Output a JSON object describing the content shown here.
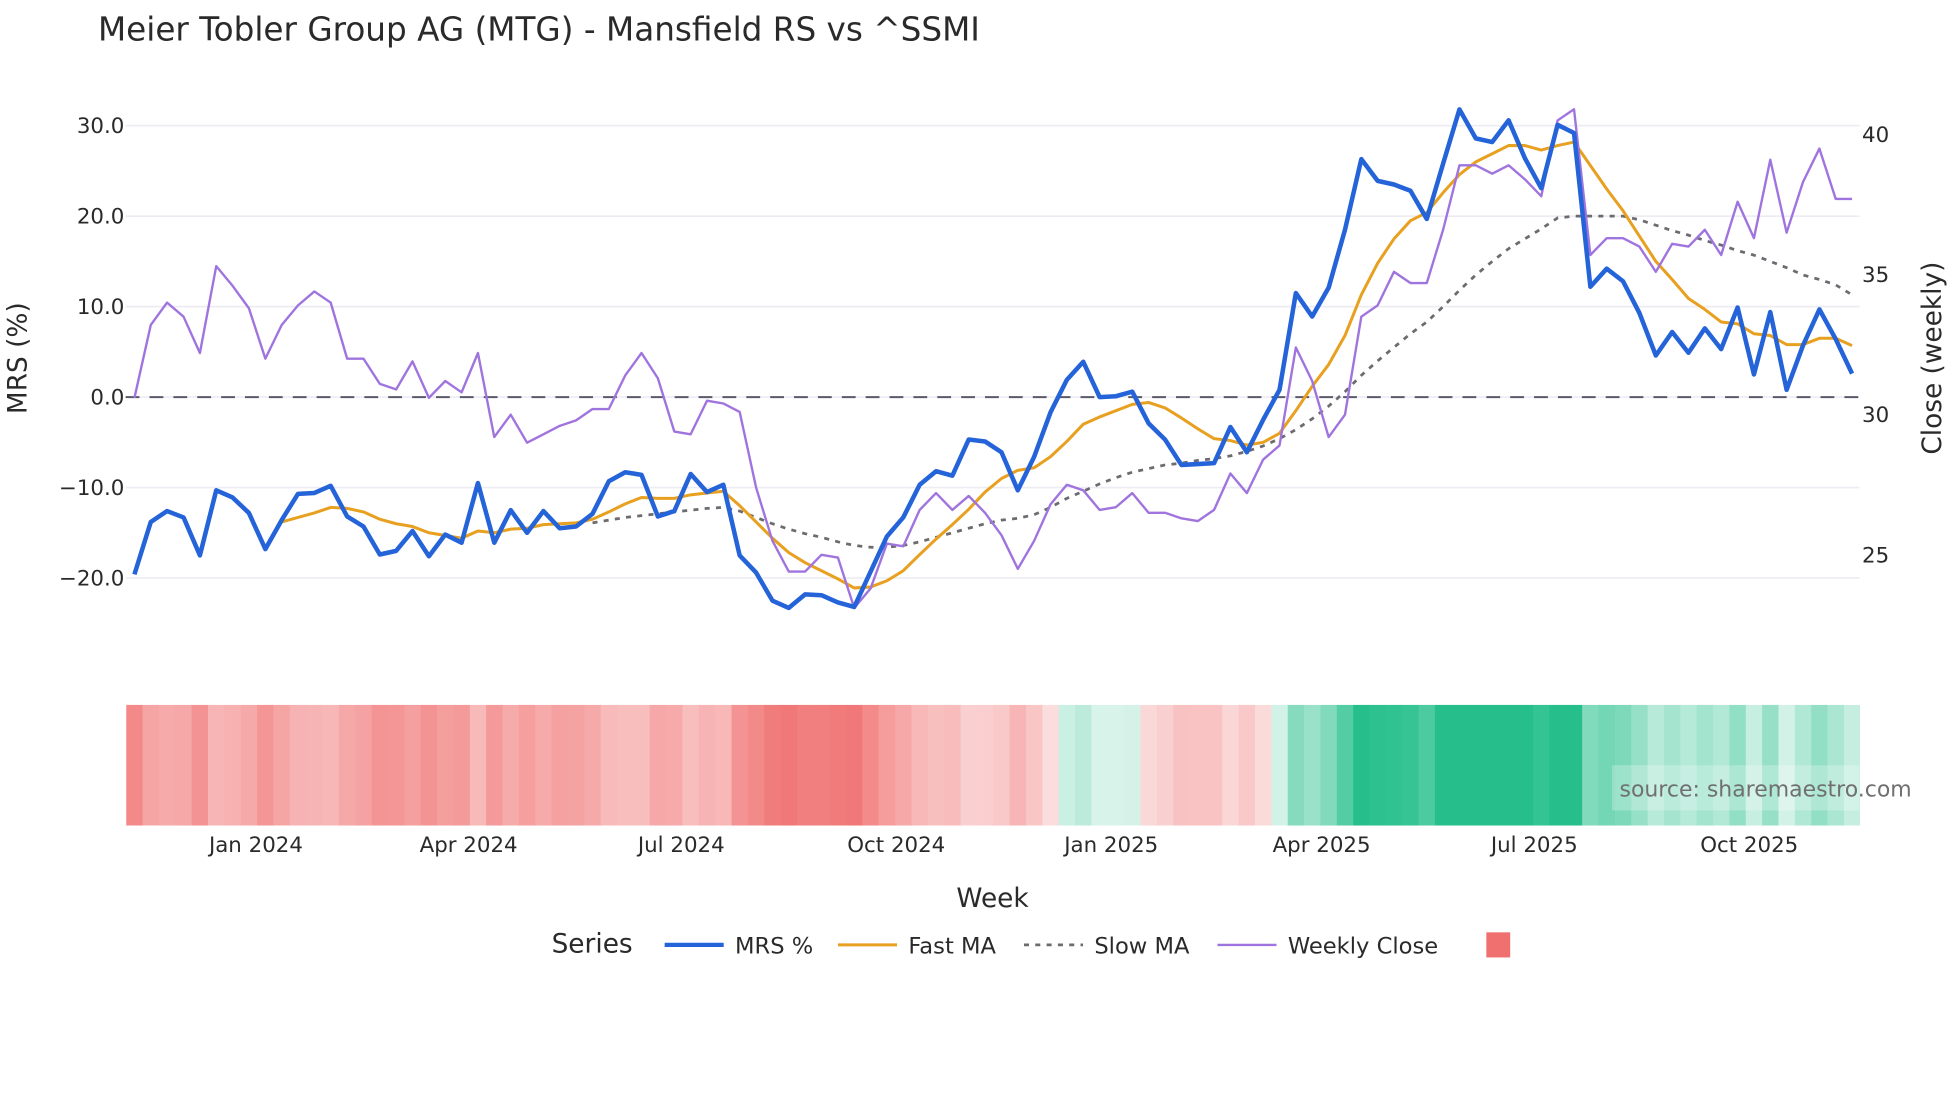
{
  "chart_data": {
    "type": "line",
    "title": "Meier Tobler Group AG (MTG) - Mansfield RS vs ^SSMI",
    "xlabel": "Week",
    "ylabel": "MRS (%)",
    "y2label": "Close (weekly)",
    "x_start": "2023-11-10",
    "x_step_days": 7,
    "x_tick_labels": [
      "Jan 2024",
      "Apr 2024",
      "Jul 2024",
      "Oct 2024",
      "Jan 2025",
      "Apr 2025",
      "Jul 2025",
      "Oct 2025"
    ],
    "x_tick_dates": [
      "2024-01-01",
      "2024-04-01",
      "2024-07-01",
      "2024-10-01",
      "2025-01-01",
      "2025-04-01",
      "2025-07-01",
      "2025-10-01"
    ],
    "y_ticks": [
      30,
      20,
      10,
      0,
      -10,
      -20
    ],
    "y_tick_labels": [
      "30.0",
      "20.0",
      "10.0",
      "0.0",
      "−10.0",
      "−20.0"
    ],
    "ylim": [
      -25,
      32
    ],
    "y2_ticks": [
      40,
      35,
      30,
      25
    ],
    "y2_tick_labels": [
      "40",
      "35",
      "30",
      "25"
    ],
    "y2lim": [
      22.6,
      40.1
    ],
    "zero_line": 0,
    "grid": true,
    "legend_title": "Series",
    "legend_placement": "bottom-center",
    "source_note": "source: sharemaestro.com",
    "colors": {
      "mrs": "#2563d9",
      "fast": "#e8a020",
      "slow": "#6b6b70",
      "close": "#a074de",
      "neg": "#f07070",
      "pos": "#26bf8c"
    },
    "series": [
      {
        "key": "mrs",
        "name": "MRS %",
        "start_index": 0,
        "values": [
          -19.6,
          -13.8,
          -12.6,
          -13.3,
          -17.5,
          -10.3,
          -11.1,
          -12.8,
          -16.8,
          -13.6,
          -10.7,
          -10.6,
          -9.8,
          -13.2,
          -14.3,
          -17.4,
          -17.0,
          -14.8,
          -17.6,
          -15.2,
          -16.1,
          -9.5,
          -16.1,
          -12.5,
          -15.0,
          -12.6,
          -14.5,
          -14.3,
          -12.9,
          -9.3,
          -8.3,
          -8.6,
          -13.2,
          -12.6,
          -8.5,
          -10.5,
          -9.7,
          -17.5,
          -19.4,
          -22.5,
          -23.3,
          -21.8,
          -21.9,
          -22.7,
          -23.2,
          -19.3,
          -15.4,
          -13.3,
          -9.7,
          -8.2,
          -8.7,
          -4.7,
          -4.9,
          -6.1,
          -10.3,
          -6.6,
          -1.7,
          1.9,
          3.9,
          0.0,
          0.1,
          0.6,
          -2.9,
          -4.7,
          -7.5,
          -7.4,
          -7.3,
          -3.3,
          -6.1,
          -2.5,
          0.8,
          11.5,
          8.9,
          12.1,
          18.5,
          26.3,
          23.9,
          23.5,
          22.8,
          19.7,
          25.8,
          31.8,
          28.6,
          28.2,
          30.6,
          26.4,
          23.1,
          30.1,
          29.2,
          12.2,
          14.2,
          12.8,
          9.3,
          4.6,
          7.2,
          4.9,
          7.6,
          5.3,
          9.9,
          2.5,
          9.4,
          0.8,
          5.7,
          9.7,
          6.4,
          2.6
        ]
      },
      {
        "key": "fast",
        "name": "Fast MA",
        "start_index": 9,
        "values": [
          -13.8,
          -13.3,
          -12.8,
          -12.2,
          -12.3,
          -12.7,
          -13.5,
          -14.0,
          -14.3,
          -15.0,
          -15.3,
          -15.6,
          -14.8,
          -15.0,
          -14.6,
          -14.5,
          -14.1,
          -14.0,
          -13.9,
          -13.5,
          -12.7,
          -11.8,
          -11.1,
          -11.2,
          -11.2,
          -10.8,
          -10.6,
          -10.4,
          -12.0,
          -13.8,
          -15.6,
          -17.2,
          -18.3,
          -19.2,
          -20.1,
          -21.1,
          -21.0,
          -20.3,
          -19.2,
          -17.4,
          -15.7,
          -14.1,
          -12.4,
          -10.5,
          -9.0,
          -8.1,
          -7.8,
          -6.6,
          -4.9,
          -3.0,
          -2.2,
          -1.5,
          -0.8,
          -0.6,
          -1.2,
          -2.3,
          -3.5,
          -4.6,
          -4.8,
          -5.3,
          -5.0,
          -4.0,
          -1.5,
          1.2,
          3.6,
          6.8,
          11.3,
          14.8,
          17.5,
          19.5,
          20.4,
          22.6,
          24.6,
          26.0,
          26.9,
          27.8,
          27.8,
          27.3,
          27.8,
          28.2,
          25.6,
          23.0,
          20.6,
          17.8,
          15.0,
          13.0,
          10.9,
          9.7,
          8.3,
          8.1,
          7.0,
          6.8,
          5.8,
          5.8,
          6.5,
          6.5,
          5.7
        ]
      },
      {
        "key": "slow",
        "name": "Slow MA",
        "start_index": 28,
        "values": [
          -13.9,
          -13.6,
          -13.3,
          -13.1,
          -12.9,
          -12.7,
          -12.5,
          -12.3,
          -12.2,
          -12.6,
          -13.3,
          -14.0,
          -14.6,
          -15.1,
          -15.5,
          -16.0,
          -16.4,
          -16.6,
          -16.6,
          -16.4,
          -16.0,
          -15.5,
          -15.0,
          -14.5,
          -14.0,
          -13.6,
          -13.4,
          -13.0,
          -12.2,
          -11.2,
          -10.4,
          -9.6,
          -8.9,
          -8.3,
          -7.9,
          -7.5,
          -7.3,
          -7.0,
          -6.8,
          -6.5,
          -6.0,
          -5.4,
          -4.6,
          -3.6,
          -2.4,
          -1.0,
          0.6,
          2.4,
          4.0,
          5.5,
          7.0,
          8.3,
          10.0,
          11.8,
          13.5,
          15.0,
          16.4,
          17.5,
          18.6,
          19.8,
          20.0,
          20.0,
          20.0,
          20.0,
          19.6,
          19.0,
          18.4,
          17.9,
          17.3,
          16.8,
          16.2,
          15.7,
          15.0,
          14.3,
          13.5,
          13.0,
          12.4,
          11.3
        ]
      },
      {
        "key": "close",
        "name": "Weekly Close",
        "axis": "y2",
        "start_index": 0,
        "values": [
          30.6,
          33.2,
          34.0,
          33.5,
          32.2,
          35.3,
          34.6,
          33.8,
          32.0,
          33.2,
          33.9,
          34.4,
          34.0,
          32.0,
          32.0,
          31.1,
          30.9,
          31.9,
          30.6,
          31.2,
          30.8,
          32.2,
          29.2,
          30.0,
          29.0,
          29.3,
          29.6,
          29.8,
          30.2,
          30.2,
          31.4,
          32.2,
          31.3,
          29.4,
          29.3,
          30.5,
          30.4,
          30.1,
          27.4,
          25.5,
          24.4,
          24.4,
          25.0,
          24.9,
          23.1,
          23.8,
          25.4,
          25.3,
          26.6,
          27.2,
          26.6,
          27.1,
          26.5,
          25.7,
          24.5,
          25.5,
          26.8,
          27.5,
          27.3,
          26.6,
          26.7,
          27.2,
          26.5,
          26.5,
          26.3,
          26.2,
          26.6,
          27.9,
          27.2,
          28.4,
          28.9,
          32.4,
          31.2,
          29.2,
          30.0,
          33.5,
          33.9,
          35.1,
          34.7,
          34.7,
          36.6,
          38.9,
          38.9,
          38.6,
          38.9,
          38.4,
          37.8,
          40.5,
          40.9,
          35.7,
          36.3,
          36.3,
          36.0,
          35.1,
          36.1,
          36.0,
          36.6,
          35.7,
          37.6,
          36.3,
          39.1,
          36.5,
          38.3,
          39.5,
          37.7,
          37.7
        ]
      }
    ],
    "heatmap": {
      "source_series": "mrs",
      "scale_abs_max": 25
    }
  }
}
